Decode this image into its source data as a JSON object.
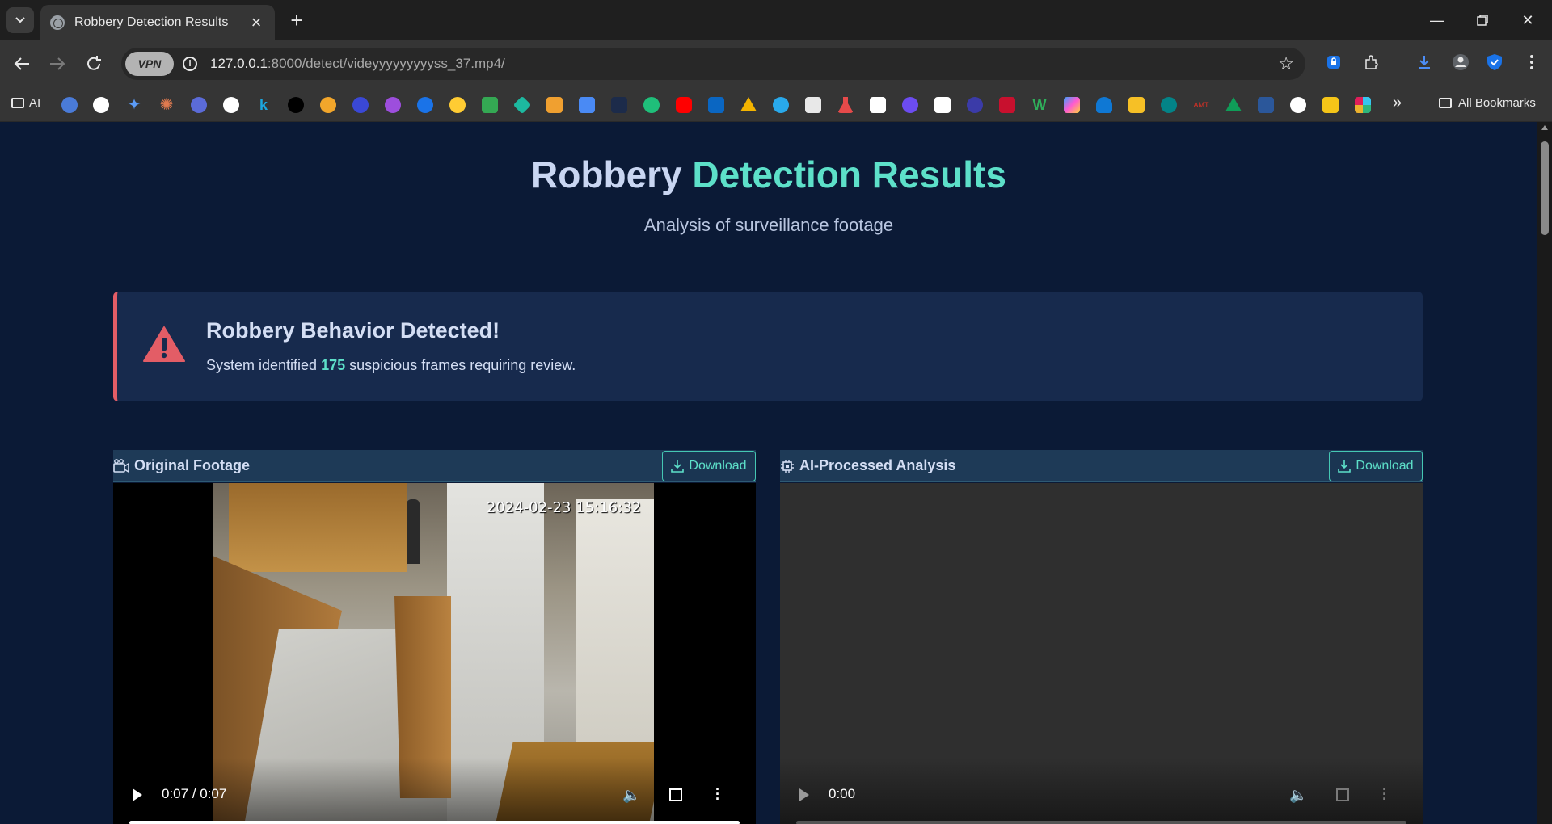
{
  "browser": {
    "tab_title": "Robbery Detection Results",
    "url_host": "127.0.0.1",
    "url_rest": ":8000/detect/videyyyyyyyyyss_37.mp4/",
    "vpn_label": "VPN",
    "bookmarks_folder": "AI",
    "all_bookmarks": "All Bookmarks"
  },
  "page": {
    "title_part1": "Robbery",
    "title_part2": "Detection Results",
    "subtitle": "Analysis of surveillance footage"
  },
  "alert": {
    "title": "Robbery Behavior Detected!",
    "text_before": "System identified",
    "count": "175",
    "text_after": "suspicious frames requiring review.",
    "color": "#e35d66"
  },
  "panels": {
    "original": {
      "title": "Original Footage",
      "download_label": "Download",
      "timestamp": "2024-02-23 15:16:32",
      "time": "0:07 / 0:07",
      "progress": 1.0
    },
    "processed": {
      "title": "AI-Processed Analysis",
      "download_label": "Download",
      "time": "0:00",
      "progress": 0.0
    }
  },
  "colors": {
    "accent": "#5de0c9",
    "background": "#0b1a36"
  }
}
